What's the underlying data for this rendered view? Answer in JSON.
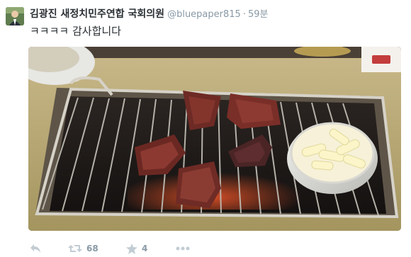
{
  "tweet": {
    "author_name": "김광진 새정치민주연합 국회의원",
    "handle": "@bluepaper815",
    "separator": "·",
    "time": "59분",
    "text": "ㅋㅋㅋㅋ 감사합니다",
    "media_icon": "grilled-beef-photo",
    "actions": {
      "reply_icon": "reply-icon",
      "retweet_icon": "retweet-icon",
      "retweet_count": "68",
      "favorite_icon": "star-icon",
      "favorite_count": "4",
      "more_icon": "more-dots-icon"
    }
  }
}
